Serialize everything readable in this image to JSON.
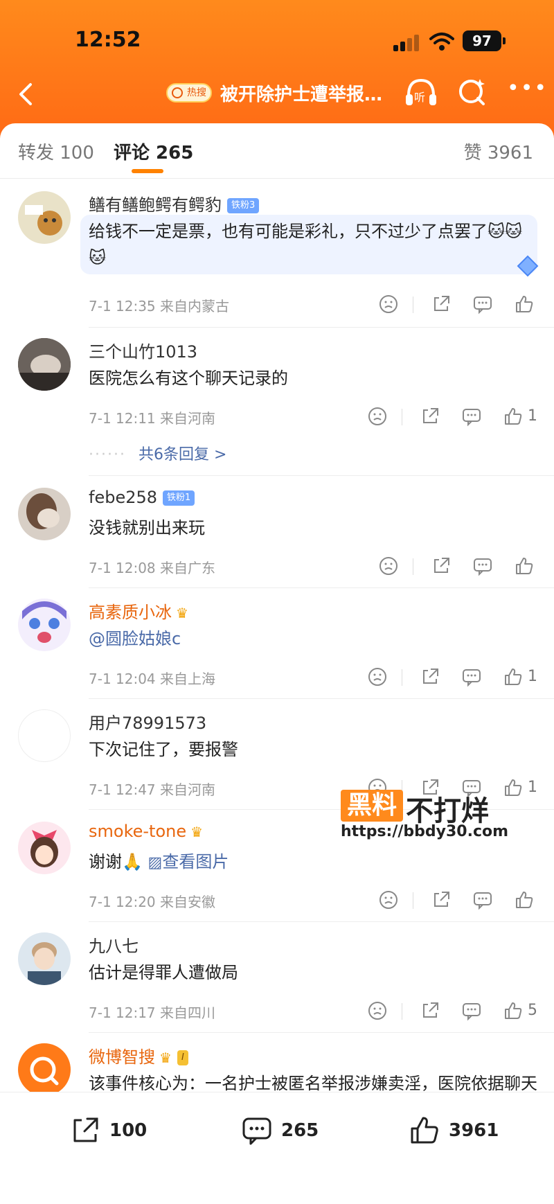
{
  "status_bar": {
    "time": "12:52",
    "battery": "97"
  },
  "nav": {
    "hot_badge": "热搜",
    "title": "被开除护士遭举报…"
  },
  "tabs": {
    "repost": "转发 100",
    "comments": "评论 265",
    "likes": "赞 3961"
  },
  "comments": [
    {
      "user": "鳝有鳝鲍鳄有鳄豹",
      "badge": "铁粉3",
      "text_line1": "给钱不一定是票，也有可能是彩礼，只不过少了点罢了🐱🐱",
      "text_line2": "🐱",
      "meta": "7-1 12:35  来自内蒙古",
      "likes": ""
    },
    {
      "user": "三个山竹1013",
      "text_line1": "医院怎么有这个聊天记录的",
      "meta": "7-1 12:11  来自河南",
      "likes": "1",
      "replies": "共6条回复 >"
    },
    {
      "user": "febe258",
      "badge": "铁粉1",
      "text_line1": "没钱就别出来玩",
      "meta": "7-1 12:08  来自广东",
      "likes": ""
    },
    {
      "user": "高素质小冰",
      "text_line1": "@圆脸姑娘c",
      "meta": "7-1 12:04  来自上海",
      "likes": "1"
    },
    {
      "user": "用户78991573",
      "text_line1": "下次记住了，要报警",
      "meta": "7-1 12:47  来自河南",
      "likes": "1"
    },
    {
      "user": "smoke-tone",
      "text_line1": "谢谢🙏",
      "image_link": "查看图片",
      "meta": "7-1 12:20  来自安徽",
      "likes": ""
    },
    {
      "user": "九八七",
      "text_line1": "估计是得罪人遭做局",
      "meta": "7-1 12:17  来自四川",
      "likes": "5"
    },
    {
      "user": "微博智搜",
      "badge": "I",
      "text_line1": "该事件核心为：一名护士被匿名举报涉嫌卖淫，医院依据聊天"
    }
  ],
  "watermark": {
    "box": "黑料",
    "text": "不打烊",
    "url": "https://bbdy30.com"
  },
  "bottom_bar": {
    "repost": "100",
    "comment": "265",
    "like": "3961"
  },
  "colors": {
    "header": "#ff7a18",
    "accent": "#ff8200",
    "link": "#4a6aa8",
    "vip_name": "#e8660e"
  }
}
